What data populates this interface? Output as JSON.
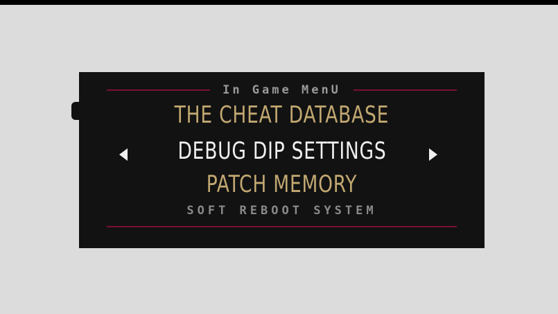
{
  "menu": {
    "title": "In Game MenU",
    "items": [
      {
        "label": "THE CHEAT DATABASE",
        "state": "normal",
        "color": "#c2a871"
      },
      {
        "label": "DEBUG DIP SETTINGS",
        "state": "selected",
        "color": "#f0f0f0"
      },
      {
        "label": "PATCH MEMORY",
        "state": "normal",
        "color": "#c2a871"
      },
      {
        "label": "SOFT REBOOT SYSTEM",
        "state": "disabled",
        "color": "#8a8a8a"
      }
    ],
    "selection_arrows": {
      "left": "arrow-left-icon",
      "right": "arrow-right-icon"
    },
    "divider_color": "#7a1030"
  }
}
